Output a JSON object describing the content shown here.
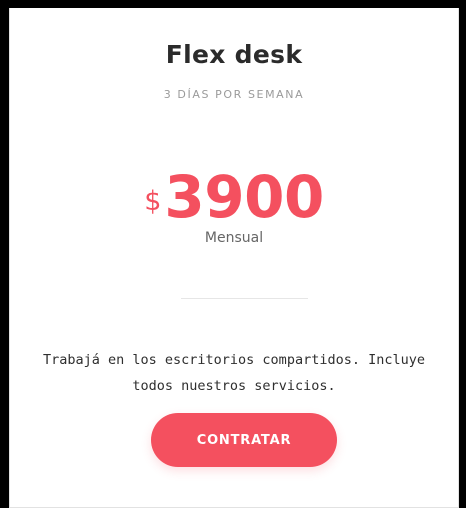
{
  "plan": {
    "title": "Flex desk",
    "subtitle": "3 DÍAS POR SEMANA",
    "currency": "$",
    "price": "3900",
    "period": "Mensual",
    "description": "Trabajá en los escritorios compartidos. Incluye todos nuestros servicios.",
    "cta_label": "CONTRATAR"
  },
  "colors": {
    "accent": "#f4505f",
    "title": "#2b2b2b",
    "muted": "#9a9a9a",
    "text": "#2f2f2f",
    "background": "#ffffff"
  }
}
